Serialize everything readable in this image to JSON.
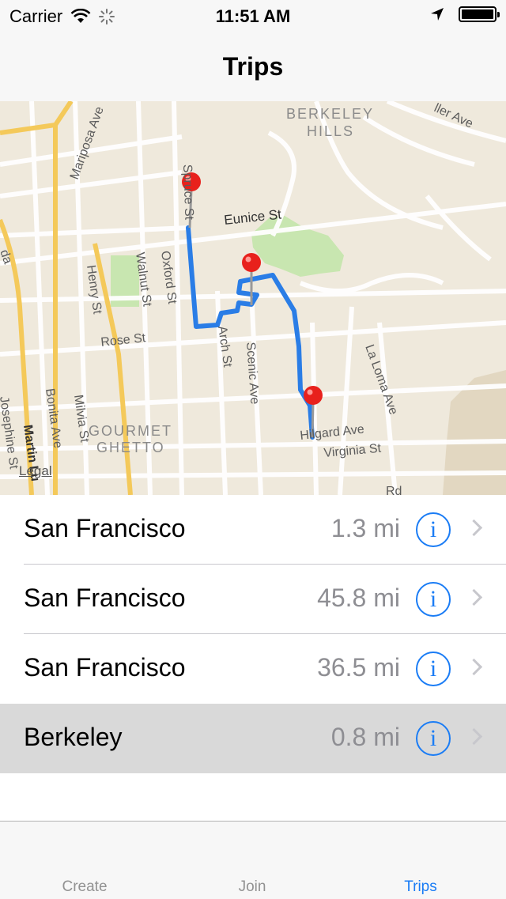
{
  "status_bar": {
    "carrier": "Carrier",
    "time": "11:51 AM"
  },
  "nav": {
    "title": "Trips"
  },
  "map": {
    "labels": {
      "berkeley_hills_1": "BERKELEY",
      "berkeley_hills_2": "HILLS",
      "eunice": "Eunice St",
      "rose": "Rose St",
      "hilgard": "Hilgard Ave",
      "virginia": "Virginia St",
      "mariposa": "Mariposa Ave",
      "spruce": "Spruce St",
      "walnut": "Walnut St",
      "oxford": "Oxford St",
      "henry": "Henry St",
      "arch": "Arch St",
      "scenic": "Scenic Ave",
      "laloma": "La Loma Ave",
      "bonita": "Bonita Ave",
      "milvia": "Milvia St",
      "josephine": "Josephine St",
      "martin": "Martin Lu",
      "gourmet1": "GOURMET",
      "gourmet2": "GHETTO",
      "euclid_partial": "ller Ave",
      "rd": "Rd",
      "da": "da"
    },
    "legal": "Legal"
  },
  "trips": [
    {
      "name": "San Francisco",
      "distance": "1.3 mi",
      "selected": false
    },
    {
      "name": "San Francisco",
      "distance": "45.8 mi",
      "selected": false
    },
    {
      "name": "San Francisco",
      "distance": "36.5 mi",
      "selected": false
    },
    {
      "name": "Berkeley",
      "distance": "0.8 mi",
      "selected": true
    }
  ],
  "tabs": [
    {
      "label": "Create",
      "active": false
    },
    {
      "label": "Join",
      "active": false
    },
    {
      "label": "Trips",
      "active": true
    }
  ],
  "colors": {
    "accent": "#1a7cf5",
    "route": "#2a7de6",
    "pin": "#e8211c",
    "park": "#c8e6b0"
  }
}
